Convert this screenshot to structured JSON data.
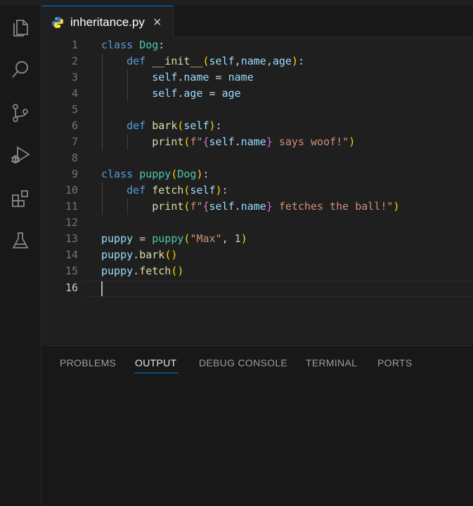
{
  "editor_tab": {
    "label": "inheritance.py",
    "close": "×"
  },
  "activity_bar": [
    "files-icon",
    "search-icon",
    "source-control-icon",
    "run-debug-icon",
    "extensions-icon",
    "testing-icon"
  ],
  "line_numbers": [
    "1",
    "2",
    "3",
    "4",
    "5",
    "6",
    "7",
    "8",
    "9",
    "10",
    "11",
    "12",
    "13",
    "14",
    "15",
    "16"
  ],
  "code": {
    "l1": {
      "k": "class",
      "c": "Dog",
      "p": ":"
    },
    "l2": {
      "k": "def",
      "f": "__init__",
      "o": "(",
      "a1": "self",
      "s1": ",",
      "a2": "name",
      "s2": ",",
      "a3": "age",
      "c": ")",
      "p": ":"
    },
    "l3": {
      "a": "self",
      "d": ".",
      "b": "name",
      "e": " = ",
      "v": "name"
    },
    "l4": {
      "a": "self",
      "d": ".",
      "b": "age",
      "e": " = ",
      "v": "age"
    },
    "l6": {
      "k": "def",
      "f": "bark",
      "o": "(",
      "a": "self",
      "c": ")",
      "p": ":"
    },
    "l7": {
      "f": "print",
      "o": "(",
      "pre": "f\"",
      "bo": "{",
      "a": "self",
      "d": ".",
      "b": "name",
      "bc": "}",
      "s": " says woof!\"",
      "c": ")"
    },
    "l9": {
      "k": "class",
      "c": "puppy",
      "o": "(",
      "base": "Dog",
      "cl": ")",
      "p": ":"
    },
    "l10": {
      "k": "def",
      "f": "fetch",
      "o": "(",
      "a": "self",
      "c": ")",
      "p": ":"
    },
    "l11": {
      "f": "print",
      "o": "(",
      "pre": "f\"",
      "bo": "{",
      "a": "self",
      "d": ".",
      "b": "name",
      "bc": "}",
      "s": " fetches the ball!\"",
      "c": ")"
    },
    "l13": {
      "v": "puppy",
      "e": " = ",
      "f": "puppy",
      "o": "(",
      "s": "\"Max\"",
      "cm": ", ",
      "n": "1",
      "c": ")"
    },
    "l14": {
      "v": "puppy",
      "d": ".",
      "f": "bark",
      "o": "(",
      "c": ")"
    },
    "l15": {
      "v": "puppy",
      "d": ".",
      "f": "fetch",
      "o": "(",
      "c": ")"
    }
  },
  "panel_tabs": [
    "PROBLEMS",
    "OUTPUT",
    "DEBUG CONSOLE",
    "TERMINAL",
    "PORTS"
  ],
  "panel_active": "OUTPUT"
}
